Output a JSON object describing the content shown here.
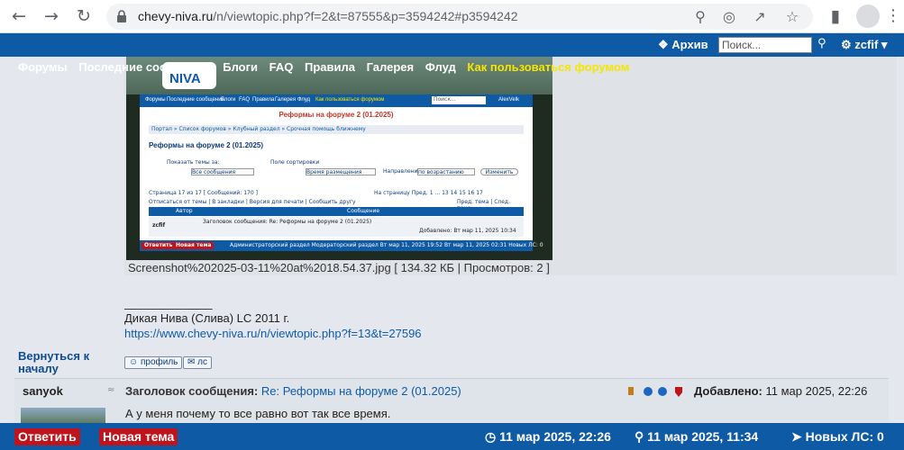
{
  "browser": {
    "url_host": "chevy-niva.ru",
    "url_path": "/n/viewtopic.php?f=2&t=87555&p=3594242#p3594242"
  },
  "topbar": {
    "archive_label": "Архив",
    "search_placeholder": "Поиск...",
    "username": "zcfif"
  },
  "nav": {
    "items": [
      "Форумы",
      "Последние сообщения",
      "Блоги",
      "FAQ",
      "Правила",
      "Галерея",
      "Флуд"
    ],
    "highlight": "Как пользоваться форумом"
  },
  "screenshot": {
    "logo_text": "NIVA",
    "inner_bar_items": [
      "Форумы",
      "Последние сообщения",
      "Блоги",
      "FAQ",
      "Правила",
      "Галерея",
      "Флуд"
    ],
    "inner_bar_highlight": "Как пользоваться форумом",
    "inner_search": "Поиск...",
    "inner_user": "AlexVelk",
    "title_banner": "Реформы на форуме 2 (01.2025)",
    "breadcrumbs": "Портал » Список форумов » Клубный раздел » Срочная помощь ближнему",
    "topic_title": "Реформы на форуме 2 (01.2025)",
    "show_label": "Показать темы за:",
    "show_value": "Все сообщения",
    "sort_label": "Поле сортировки",
    "sort_value": "Время размещения",
    "dir_label": "Направление",
    "dir_value": "по возрастанию",
    "change_btn": "Изменить",
    "page_info": "Страница 17 из 17 [ Сообщений: 170 ]",
    "pages": "На страницу Пред. 1 ... 13 14 15 16 17",
    "links_left": "Отписаться от темы | В закладки | Версия для печати | Сообщить другу",
    "links_right": "Пред. тема | След. тема",
    "col_author": "Автор",
    "col_message": "Сообщение",
    "row_author": "zcfif",
    "row_subject": "Заголовок сообщения: Re: Реформы на форуме 2 (01.2025)",
    "row_added": "Добавлено: Вт мар 11, 2025 10:34",
    "footer_btn1": "Ответить",
    "footer_btn2": "Новая тема",
    "footer_right": "Администраторский раздел  Модераторский раздел  Вт мар 11, 2025 19:52  Вт мар 11, 2025 02:31  Новых ЛС: 0"
  },
  "attachment": {
    "caption": "Screenshot%202025-03-11%20at%2018.54.37.jpg [ 134.32 КБ | Просмотров: 2 ]"
  },
  "signature": {
    "line": "_______________",
    "text": "Дикая Нива (Слива) LC 2011 г.",
    "link": "https://www.chevy-niva.ru/n/viewtopic.php?f=13&t=27596"
  },
  "post_actions": {
    "back_to_top": "Вернуться к началу",
    "profile_btn": "профиль",
    "pm_btn": "лс"
  },
  "post2": {
    "author": "sanyok",
    "subject_label": "Заголовок сообщения:",
    "subject": "Re: Реформы на форуме 2 (01.2025)",
    "added_label": "Добавлено:",
    "added_value": "11 мар 2025, 22:26",
    "text": "А у меня почему то все равно вот так все время."
  },
  "bottombar": {
    "reply": "Ответить",
    "new_topic": "Новая тема",
    "time1": "11 мар 2025, 22:26",
    "time2": "11 мар 2025, 11:34",
    "pm": "Новых ЛС: 0"
  }
}
